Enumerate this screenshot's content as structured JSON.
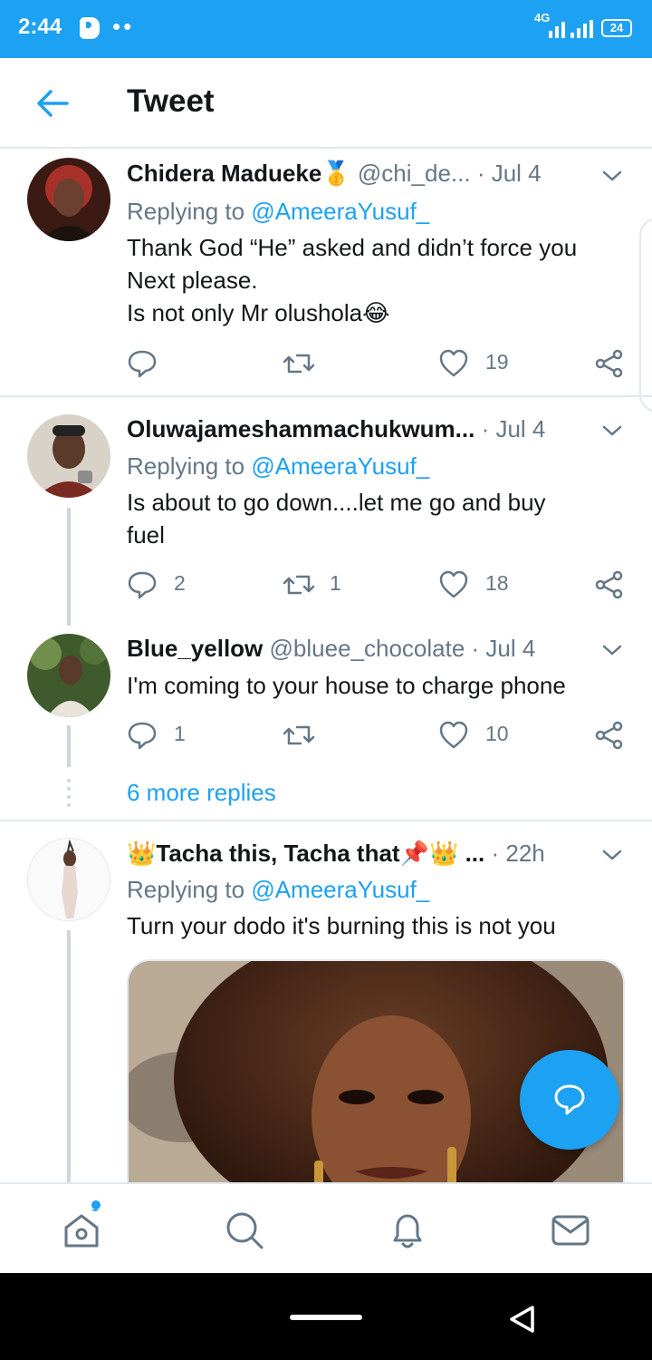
{
  "status_bar": {
    "time": "2:44",
    "network": "4G",
    "battery": "24"
  },
  "header": {
    "title": "Tweet"
  },
  "colors": {
    "accent": "#1da1f2",
    "text": "#14171a",
    "secondary": "#657786",
    "divider": "#e1e8ed"
  },
  "tweets": [
    {
      "name": "Chidera Madueke",
      "badge": "🥇",
      "handle": "@chi_de...",
      "sep": " · ",
      "date": "Jul 4",
      "replying_prefix": "Replying to ",
      "replying_to": "@AmeeraYusuf_",
      "lines": [
        "Thank God “He” asked and didn’t force you",
        "Next please.",
        "Is not only Mr olushola😂"
      ],
      "replies": "",
      "retweets": "",
      "likes": "19"
    },
    {
      "name": "Oluwajameshammachukwum...",
      "sep": " · ",
      "date": "Jul 4",
      "replying_prefix": "Replying to ",
      "replying_to": "@AmeeraYusuf_",
      "lines": [
        "Is about to go down....let me go and buy",
        "fuel"
      ],
      "replies": "2",
      "retweets": "1",
      "likes": "18"
    },
    {
      "name": "Blue_yellow",
      "handle": "@bluee_chocolate",
      "sep": " · ",
      "date": "Jul 4",
      "lines": [
        "I'm coming to your house to charge phone"
      ],
      "replies": "1",
      "retweets": "",
      "likes": "10"
    },
    {
      "name_prefix": "👑",
      "name": "Tacha this, Tacha that",
      "name_suffix": "📌👑",
      "ellipsis": " ...",
      "sep": " · ",
      "date": "22h",
      "replying_prefix": "Replying to ",
      "replying_to": "@AmeeraYusuf_",
      "lines": [
        "Turn your dodo it's burning this is not you"
      ]
    }
  ],
  "more_replies": "6 more replies",
  "bottom_nav": [
    "home-icon",
    "search-icon",
    "notifications-icon",
    "messages-icon"
  ]
}
